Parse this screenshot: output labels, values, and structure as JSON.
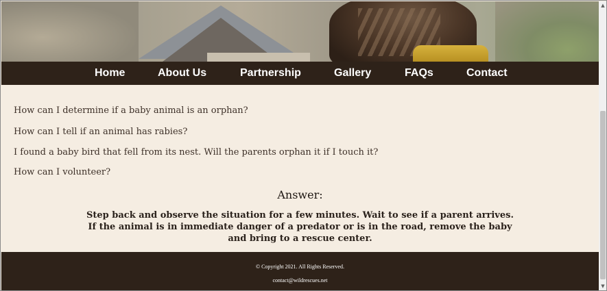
{
  "nav": {
    "items": [
      {
        "label": "Home"
      },
      {
        "label": "About Us"
      },
      {
        "label": "Partnership"
      },
      {
        "label": "Gallery"
      },
      {
        "label": "FAQs"
      },
      {
        "label": "Contact"
      }
    ]
  },
  "faq": {
    "questions": [
      {
        "text": "How can I determine if a baby animal is an orphan?"
      },
      {
        "text": "How can I tell if an animal has rabies?"
      },
      {
        "text": "I found a baby bird that fell from its nest. Will the parents orphan it if I touch it?"
      },
      {
        "text": "How can I volunteer?"
      }
    ],
    "answer_heading": "Answer:",
    "answer_text": "Step back and observe the situation for a few minutes. Wait to see if a parent arrives. If the animal is in immediate danger of a predator or is in the road, remove the baby and bring to a rescue center."
  },
  "footer": {
    "copyright": "© Copyright 2021. All Rights Reserved.",
    "contact_email": "contact@wildrescues.net"
  },
  "colors": {
    "nav_background": "#2e2219",
    "page_background": "#f5ede2",
    "text": "#3d3028"
  },
  "icons": {
    "scroll_up": "▲",
    "scroll_down": "▼"
  }
}
